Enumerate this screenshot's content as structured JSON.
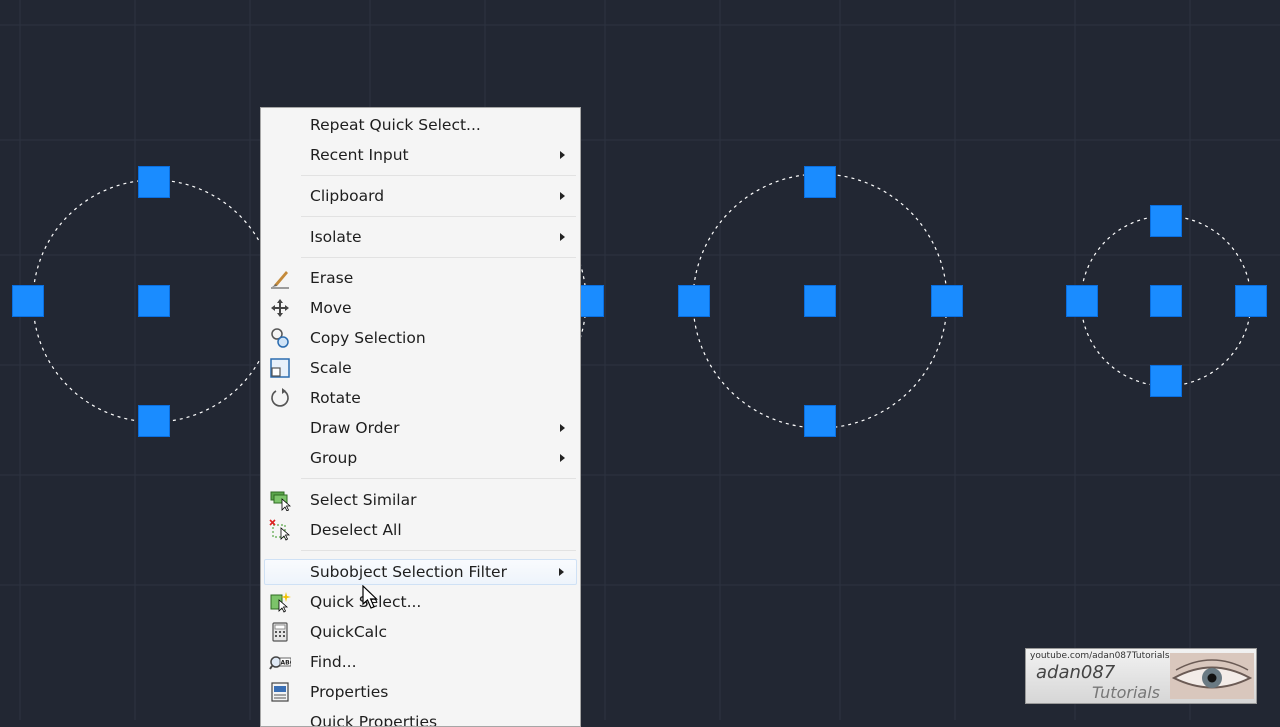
{
  "context_menu": {
    "items": [
      {
        "label": "Repeat Quick Select...",
        "icon": "",
        "submenu": false
      },
      {
        "label": "Recent Input",
        "icon": "",
        "submenu": true
      },
      {
        "label": "Clipboard",
        "icon": "",
        "submenu": true
      },
      {
        "label": "Isolate",
        "icon": "",
        "submenu": true
      },
      {
        "label": "Erase",
        "icon": "eraser-icon",
        "submenu": false
      },
      {
        "label": "Move",
        "icon": "move-icon",
        "submenu": false
      },
      {
        "label": "Copy Selection",
        "icon": "copy-selection-icon",
        "submenu": false
      },
      {
        "label": "Scale",
        "icon": "scale-icon",
        "submenu": false
      },
      {
        "label": "Rotate",
        "icon": "rotate-icon",
        "submenu": false
      },
      {
        "label": "Draw Order",
        "icon": "",
        "submenu": true
      },
      {
        "label": "Group",
        "icon": "",
        "submenu": true
      },
      {
        "label": "Select Similar",
        "icon": "select-similar-icon",
        "submenu": false
      },
      {
        "label": "Deselect All",
        "icon": "deselect-all-icon",
        "submenu": false
      },
      {
        "label": "Subobject Selection Filter",
        "icon": "",
        "submenu": true,
        "highlighted": true
      },
      {
        "label": "Quick Select...",
        "icon": "quick-select-icon",
        "submenu": false
      },
      {
        "label": "QuickCalc",
        "icon": "calculator-icon",
        "submenu": false
      },
      {
        "label": "Find...",
        "icon": "find-text-icon",
        "submenu": false
      },
      {
        "label": "Properties",
        "icon": "properties-icon",
        "submenu": false
      },
      {
        "label": "Quick Properties",
        "icon": "",
        "submenu": false
      }
    ]
  },
  "colors": {
    "canvas_background": "#222733",
    "grip": "#1a8cff",
    "menu_background": "#f5f5f5"
  },
  "watermark": {
    "url": "youtube.com/adan087Tutorials",
    "name": "adan087",
    "subtitle": "Tutorials"
  }
}
